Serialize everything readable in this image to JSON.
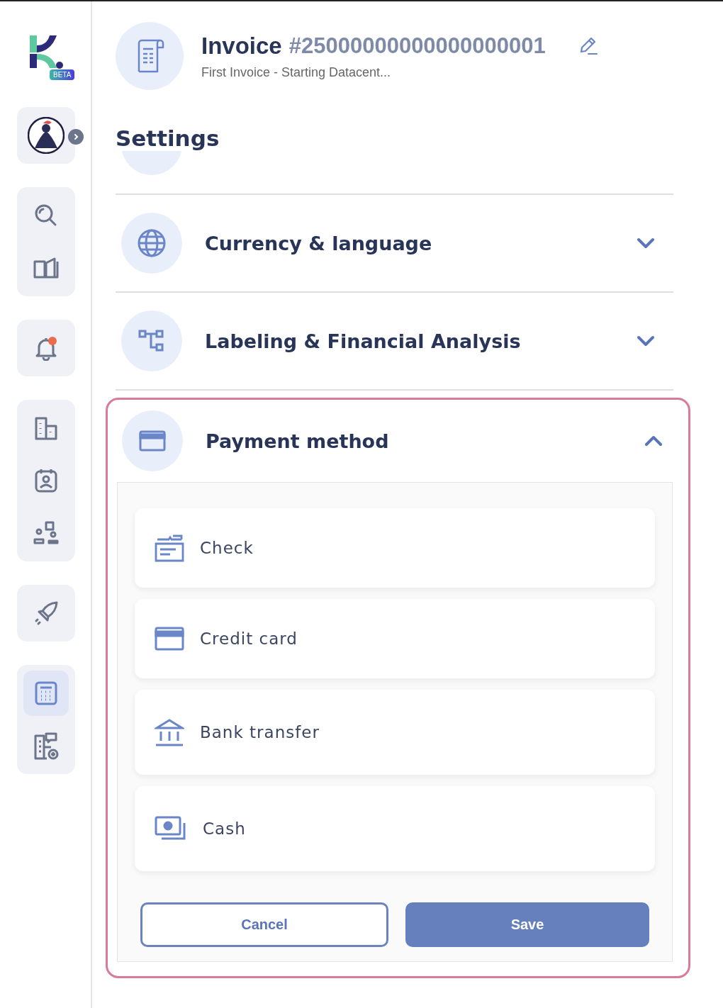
{
  "sidebar": {
    "logo_badge": "BETA",
    "groups": [
      {
        "items": [
          {
            "kind": "avatar",
            "selected": false
          }
        ]
      },
      {
        "items": [
          {
            "kind": "search",
            "selected": false
          },
          {
            "kind": "book",
            "selected": false
          }
        ]
      },
      {
        "items": [
          {
            "kind": "bell",
            "selected": false,
            "notification": true
          }
        ]
      },
      {
        "items": [
          {
            "kind": "building",
            "selected": false
          },
          {
            "kind": "calendar",
            "selected": false
          },
          {
            "kind": "shapes",
            "selected": false
          }
        ]
      },
      {
        "items": [
          {
            "kind": "rocket",
            "selected": false
          }
        ]
      },
      {
        "items": [
          {
            "kind": "calculator",
            "selected": true
          },
          {
            "kind": "office",
            "selected": false
          }
        ]
      }
    ]
  },
  "header": {
    "title": "Invoice",
    "number": "#25000000000000000001",
    "subtitle": "First Invoice - Starting Datacent..."
  },
  "heading": "Settings",
  "sections": [
    {
      "kind": "globe",
      "title": "Currency & language",
      "expanded": false
    },
    {
      "kind": "tree",
      "title": "Labeling & Financial Analysis",
      "expanded": false
    },
    {
      "kind": "card",
      "title": "Payment method",
      "expanded": true
    }
  ],
  "payment_options": [
    {
      "kind": "check",
      "label": "Check"
    },
    {
      "kind": "card",
      "label": "Credit card"
    },
    {
      "kind": "bank",
      "label": "Bank transfer"
    },
    {
      "kind": "cash",
      "label": "Cash"
    }
  ],
  "buttons": {
    "cancel": "Cancel",
    "save": "Save"
  }
}
